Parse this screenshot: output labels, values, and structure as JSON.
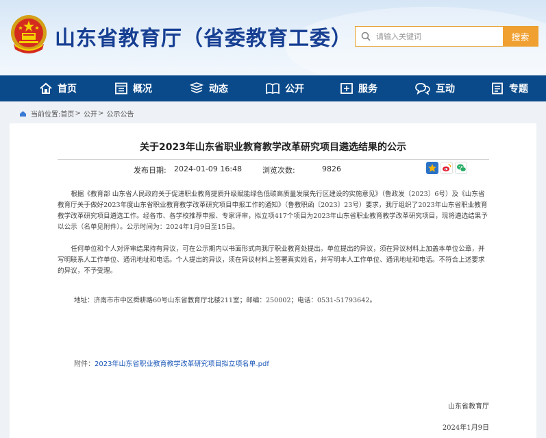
{
  "header": {
    "site_title": "山东省教育厅（省委教育工委）",
    "search_placeholder": "请输入关键词",
    "search_button": "搜索"
  },
  "nav": [
    {
      "label": "首页",
      "icon": "home-icon"
    },
    {
      "label": "概况",
      "icon": "overview-icon"
    },
    {
      "label": "动态",
      "icon": "news-icon"
    },
    {
      "label": "公开",
      "icon": "book-icon"
    },
    {
      "label": "服务",
      "icon": "service-icon"
    },
    {
      "label": "互动",
      "icon": "chat-icon"
    },
    {
      "label": "专题",
      "icon": "topic-icon"
    }
  ],
  "breadcrumb": {
    "prefix": "当前位置:",
    "items": [
      "首页",
      "公开",
      "公示公告"
    ],
    "separator": ">"
  },
  "article": {
    "title": "关于2023年山东省职业教育教学改革研究项目遴选结果的公示",
    "publish_label": "发布日期:",
    "publish_date": "2024-01-09 16:48",
    "views_label": "浏览次数:",
    "views": "9826",
    "paragraph_1": "根据《教育部 山东省人民政府关于促进职业教育提质升级赋能绿色低碳高质量发展先行区建设的实施意见》（鲁政发〔2023〕6号）及《山东省教育厅关于做好2023年度山东省职业教育教学改革研究项目申报工作的通知》（鲁教职函〔2023〕23号）要求，我厅组织了2023年山东省职业教育教学改革研究项目遴选工作。经各市、各学校推荐申报、专家评审，拟立项417个项目为2023年山东省职业教育教学改革研究项目，现将遴选结果予以公示（名单见附件）。公示时间为：2024年1月9日至15日。",
    "paragraph_2": "任何单位和个人对评审结果持有异议，可在公示期内以书面形式向我厅职业教育处提出。单位提出的异议，须在异议材料上加盖本单位公章，并写明联系人工作单位、通讯地址和电话。个人提出的异议，须在异议材料上签署真实姓名，并写明本人工作单位、通讯地址和电话。不符合上述要求的异议，不予受理。",
    "address": "地址：济南市市中区舜耕路60号山东省教育厅北楼211室；邮编：250002；电话：0531-51793642。",
    "attachment_label": "附件：",
    "attachment_link": "2023年山东省职业教育教学改革研究项目拟立项名单.pdf",
    "signature_org": "山东省教育厅",
    "signature_date": "2024年1月9日"
  },
  "share": [
    {
      "icon": "qzone-star-icon",
      "color": "#f5b400"
    },
    {
      "icon": "weibo-icon",
      "color": "#e6162d"
    },
    {
      "icon": "wechat-icon",
      "color": "#2aae67"
    }
  ],
  "colors": {
    "brand": "#163e92",
    "nav_bg": "#0a4a8a",
    "accent": "#f0a030",
    "link": "#1a56b8"
  }
}
